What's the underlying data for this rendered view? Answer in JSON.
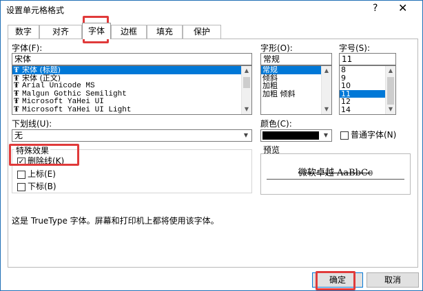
{
  "window": {
    "title": "设置单元格格式",
    "help": "?",
    "close": "✕"
  },
  "tabs": [
    {
      "label": "数字"
    },
    {
      "label": "对齐"
    },
    {
      "label": "字体"
    },
    {
      "label": "边框"
    },
    {
      "label": "填充"
    },
    {
      "label": "保护"
    }
  ],
  "font": {
    "label": "字体(F):",
    "value": "宋体",
    "items": [
      {
        "label": "宋体 (标题)",
        "selected": true
      },
      {
        "label": "宋体 (正文)",
        "selected": false
      },
      {
        "label": "Arial Unicode MS",
        "selected": false
      },
      {
        "label": "Malgun Gothic Semilight",
        "selected": false
      },
      {
        "label": "Microsoft YaHei UI",
        "selected": false
      },
      {
        "label": "Microsoft YaHei UI Light",
        "selected": false
      }
    ]
  },
  "style": {
    "label": "字形(O):",
    "value": "常规",
    "items": [
      {
        "label": "常规",
        "selected": true
      },
      {
        "label": "倾斜",
        "selected": false
      },
      {
        "label": "加粗",
        "selected": false
      },
      {
        "label": "加粗 倾斜",
        "selected": false
      }
    ]
  },
  "size": {
    "label": "字号(S):",
    "value": "11",
    "items": [
      {
        "label": "8",
        "selected": false
      },
      {
        "label": "9",
        "selected": false
      },
      {
        "label": "10",
        "selected": false
      },
      {
        "label": "11",
        "selected": true
      },
      {
        "label": "12",
        "selected": false
      },
      {
        "label": "14",
        "selected": false
      }
    ]
  },
  "underline": {
    "label": "下划线(U):",
    "value": "无"
  },
  "color": {
    "label": "颜色(C):",
    "swatch": "#000000"
  },
  "normal_font": {
    "label": "普通字体(N)",
    "checked": false
  },
  "effects": {
    "title": "特殊效果",
    "strikethrough": {
      "label": "删除线(K)",
      "checked": true
    },
    "superscript": {
      "label": "上标(E)",
      "checked": false
    },
    "subscript": {
      "label": "下标(B)",
      "checked": false
    }
  },
  "preview": {
    "title": "预览",
    "sample": "微软卓越  AaBbCc"
  },
  "info": "这是 TrueType 字体。屏幕和打印机上都将使用该字体。",
  "buttons": {
    "ok": "确定",
    "cancel": "取消"
  },
  "colors": {
    "highlight": "#e03a3a",
    "selection": "#0078d7"
  }
}
